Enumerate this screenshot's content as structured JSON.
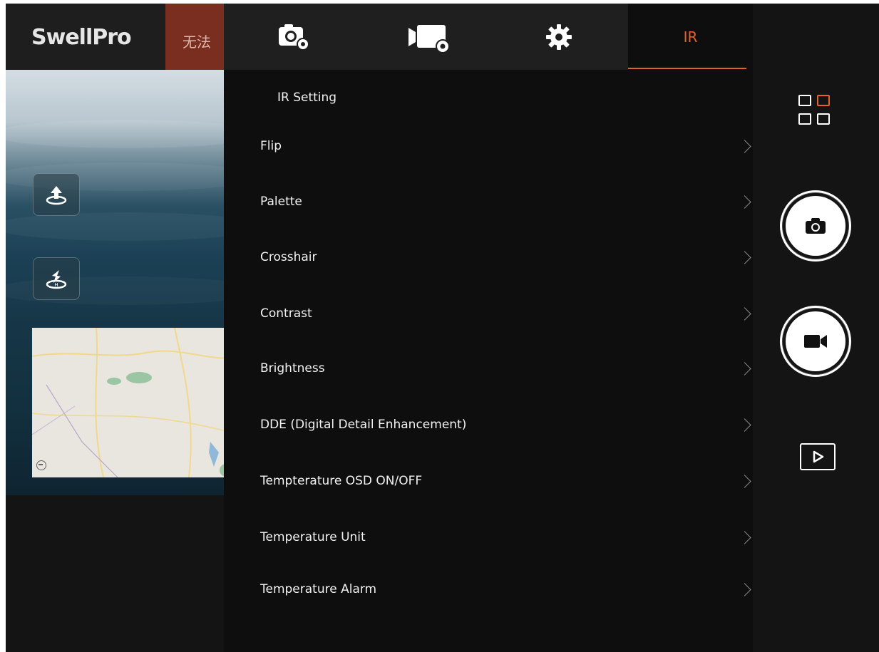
{
  "header": {
    "brand": "SwellPro",
    "status_text": "无法"
  },
  "tabs": [
    {
      "name": "camera-settings",
      "icon": "camera-gear-icon"
    },
    {
      "name": "video-settings",
      "icon": "video-gear-icon"
    },
    {
      "name": "general-settings",
      "icon": "gear-icon"
    },
    {
      "name": "ir",
      "label": "IR",
      "active": true
    }
  ],
  "panel": {
    "section_title": "IR Setting",
    "items": [
      {
        "label": "Flip"
      },
      {
        "label": "Palette"
      },
      {
        "label": "Crosshair"
      },
      {
        "label": "Contrast"
      },
      {
        "label": "Brightness"
      },
      {
        "label": "DDE (Digital Detail Enhancement)"
      },
      {
        "label": "Tempterature OSD ON/OFF"
      },
      {
        "label": "Temperature Unit"
      },
      {
        "label": "Temperature Alarm"
      }
    ]
  },
  "controls": {
    "layout_icon": "grid-icon",
    "photo_icon": "camera-icon",
    "record_icon": "video-camera-icon",
    "playback_icon": "play-icon"
  },
  "colors": {
    "accent": "#e5622b",
    "panel_bg": "#0e0e0e",
    "tab_bar_bg": "#1f1f1f"
  }
}
